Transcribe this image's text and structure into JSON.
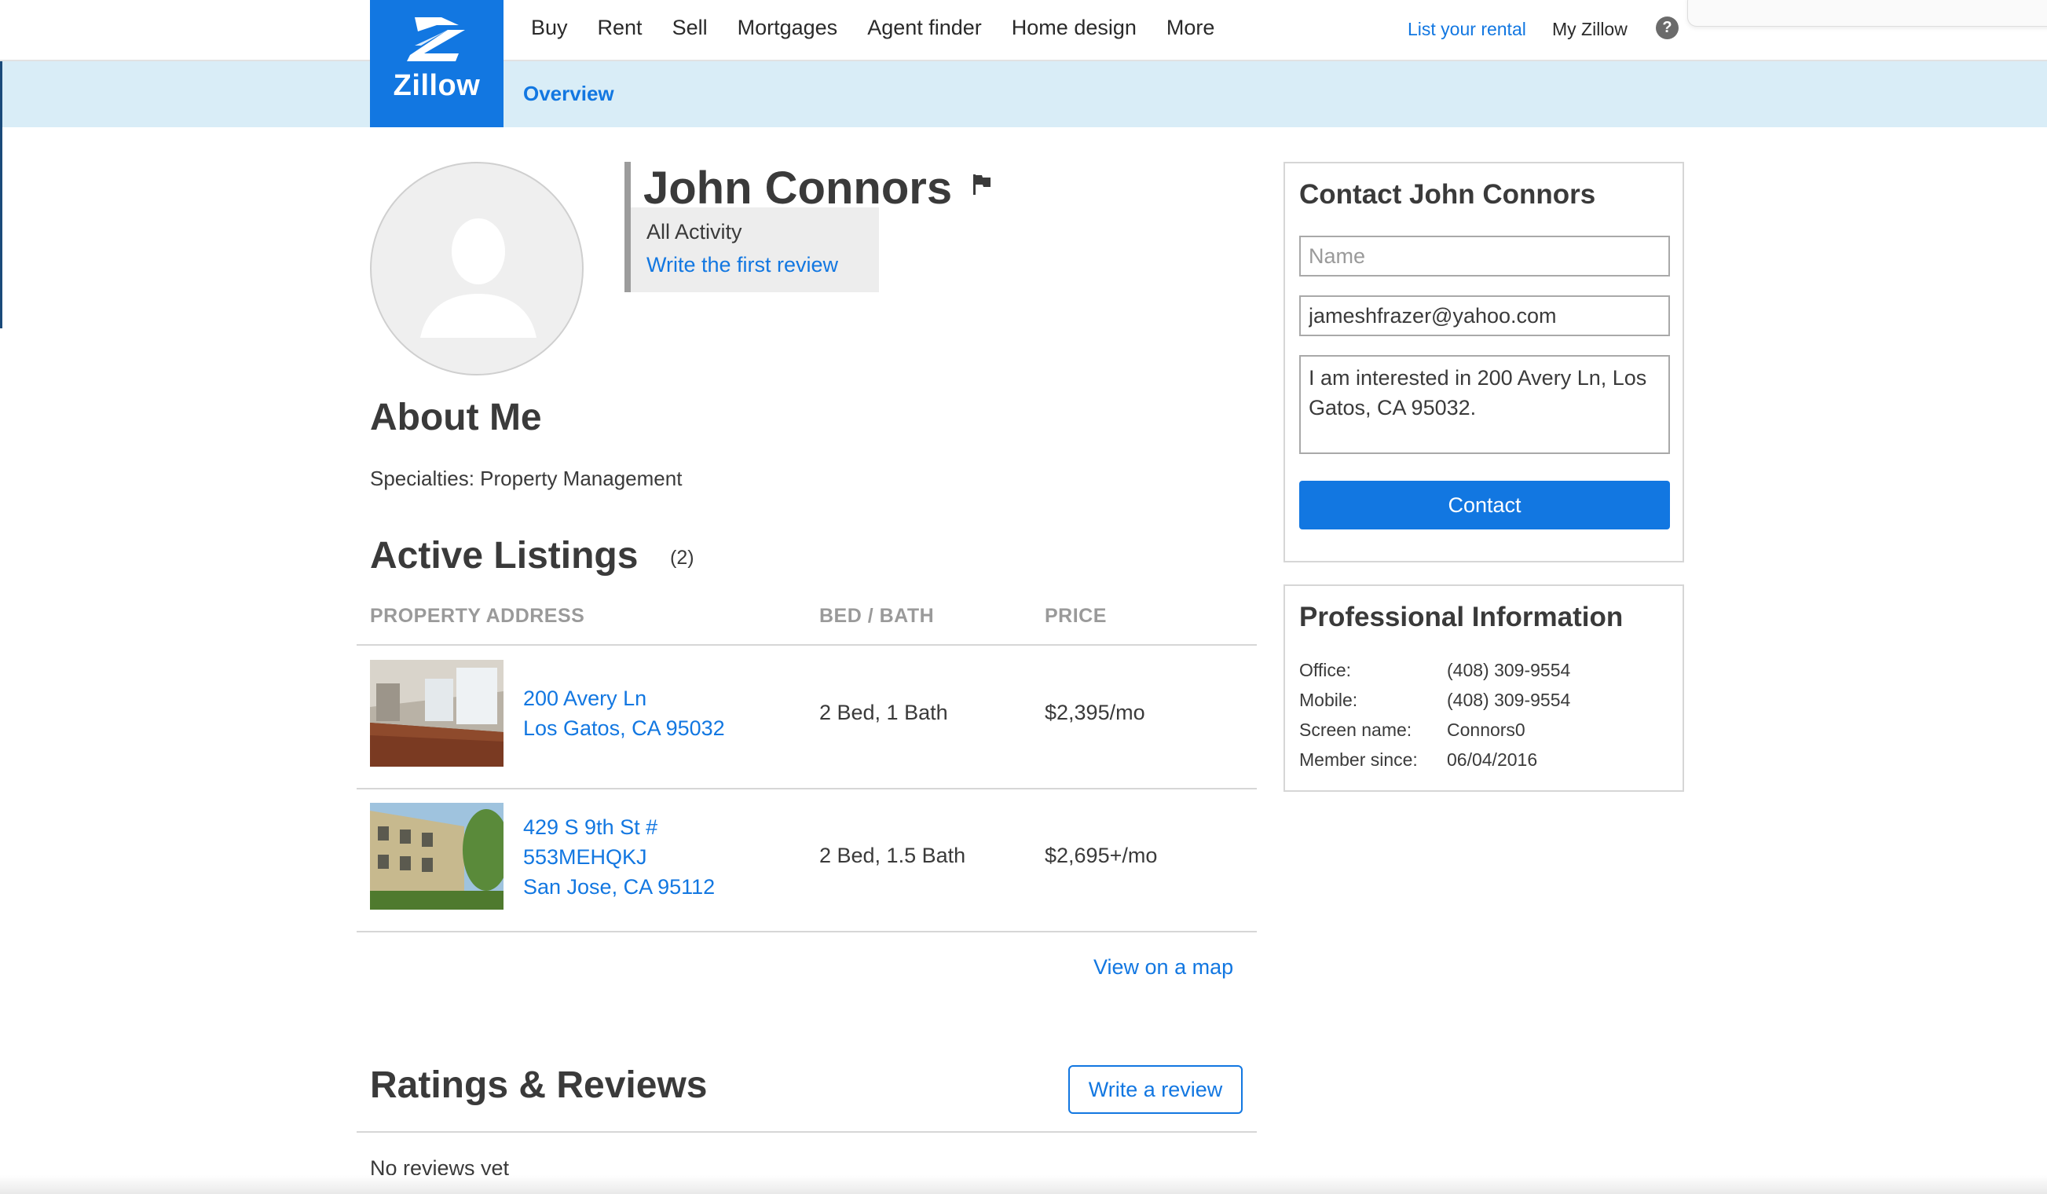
{
  "brand": {
    "name": "Zillow",
    "color": "#1277e1"
  },
  "nav": {
    "items": [
      "Buy",
      "Rent",
      "Sell",
      "Mortgages",
      "Agent finder",
      "Home design",
      "More"
    ],
    "list_rental": "List your rental",
    "my_zillow": "My Zillow",
    "help": "?"
  },
  "subnav": {
    "overview": "Overview"
  },
  "profile": {
    "name": "John Connors",
    "all_activity": "All Activity",
    "write_first_review": "Write the first review"
  },
  "about": {
    "title": "About Me",
    "specialties": "Specialties: Property Management"
  },
  "listings": {
    "title": "Active Listings",
    "count": "(2)",
    "columns": [
      "PROPERTY ADDRESS",
      "BED / BATH",
      "PRICE"
    ],
    "rows": [
      {
        "address_line1": "200 Avery Ln",
        "address_line2": "Los Gatos, CA 95032",
        "address_line3": "",
        "bed_bath": "2 Bed, 1 Bath",
        "price": "$2,395/mo"
      },
      {
        "address_line1": "429 S 9th St #",
        "address_line2": "553MEHQKJ",
        "address_line3": "San Jose, CA 95112",
        "bed_bath": "2 Bed, 1.5 Bath",
        "price": "$2,695+/mo"
      }
    ],
    "view_map": "View on a map"
  },
  "reviews": {
    "title": "Ratings & Reviews",
    "write_button": "Write a review",
    "empty": "No reviews yet"
  },
  "contact": {
    "title": "Contact John Connors",
    "name_placeholder": "Name",
    "email_value": "jameshfrazer@yahoo.com",
    "message_value": "I am interested in 200 Avery Ln, Los Gatos, CA 95032.",
    "button": "Contact"
  },
  "pro_info": {
    "title": "Professional Information",
    "rows": [
      {
        "label": "Office:",
        "value": "(408) 309-9554"
      },
      {
        "label": "Mobile:",
        "value": "(408) 309-9554"
      },
      {
        "label": "Screen name:",
        "value": "Connors0"
      },
      {
        "label": "Member since:",
        "value": "06/04/2016"
      }
    ]
  }
}
